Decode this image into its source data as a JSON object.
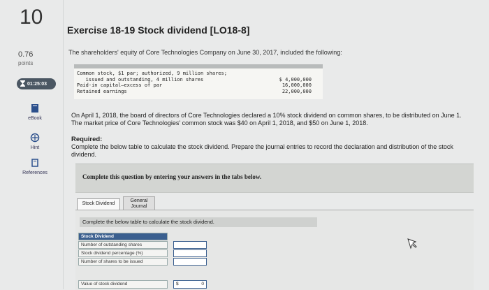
{
  "question": {
    "number": "10",
    "points_value": "0.76",
    "points_label": "points",
    "timer": "01:25:03"
  },
  "tools": [
    {
      "label": "eBook",
      "icon": "ebook-icon"
    },
    {
      "label": "Hint",
      "icon": "hint-icon"
    },
    {
      "label": "References",
      "icon": "references-icon"
    }
  ],
  "exercise": {
    "title": "Exercise 18-19 Stock dividend [LO18-8]",
    "intro": "The shareholders' equity of Core Technologies Company on June 30, 2017, included the following:",
    "equity_lines": [
      "Common stock, $1 par; authorized, 9 million shares;",
      "   issued and outstanding, 4 million shares",
      "Paid-in capital—excess of par",
      "Retained earnings"
    ],
    "equity_amounts": [
      "",
      "$ 4,000,000",
      "16,000,000",
      "22,000,000"
    ],
    "paragraph": "On April 1, 2018, the board of directors of Core Technologies declared a 10% stock dividend on common shares, to be distributed on June 1. The market price of Core Technologies' common stock was $40 on April 1, 2018, and $50 on June 1, 2018.",
    "required_title": "Required:",
    "required_text": "Complete the below table to calculate the stock dividend. Prepare the journal entries to record the declaration and distribution of the stock dividend."
  },
  "banner": "Complete this question by entering your answers in the tabs below.",
  "tabs": {
    "active": "Stock Dividend",
    "other_line1": "General",
    "other_line2": "Journal"
  },
  "panel": {
    "instruction": "Complete the below table to calculate the stock dividend.",
    "header": "Stock Dividend",
    "rows": [
      "Number of outstanding shares",
      "Stock dividend percentage (%)",
      "Number of shares to be issued"
    ],
    "value_row": {
      "label": "Value of stock dividend",
      "currency": "$",
      "value": "0"
    }
  }
}
